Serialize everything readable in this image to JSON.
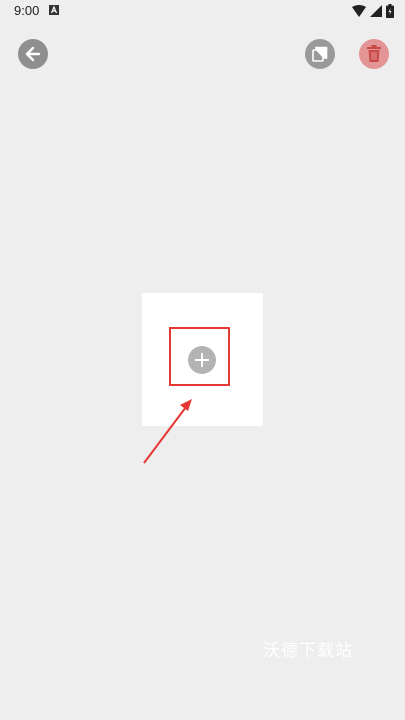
{
  "status_bar": {
    "time": "9:00",
    "notification_icon": "a-letter-icon",
    "wifi_icon": "wifi-icon",
    "signal_icon": "signal-icon",
    "battery_icon": "battery-icon"
  },
  "toolbar": {
    "back_icon": "arrow-left-icon",
    "copy_icon": "copy-icon",
    "delete_icon": "trash-icon"
  },
  "content": {
    "add_icon": "plus-icon"
  },
  "annotation": {
    "highlight_color": "#e53935"
  },
  "watermark": "沃德下载站",
  "colors": {
    "background": "#eeeeee",
    "card": "#ffffff",
    "delete_tint": "#e39595"
  }
}
